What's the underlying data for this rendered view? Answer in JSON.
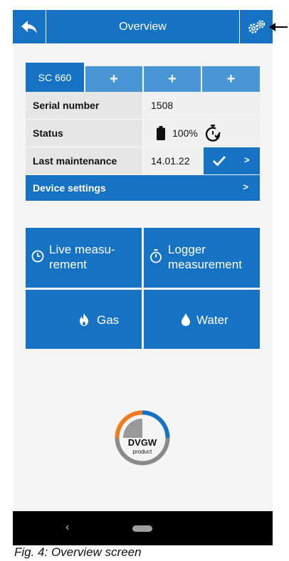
{
  "header": {
    "title": "Overview"
  },
  "tabs": {
    "active_label": "SC 660",
    "add_label": "+"
  },
  "info_rows": {
    "serial": {
      "label": "Serial number",
      "value": "1508"
    },
    "status": {
      "label": "Status",
      "battery_value": "100%"
    },
    "maintenance": {
      "label": "Last maintenance",
      "value": "14.01.22",
      "chevron": ">"
    }
  },
  "device_settings": {
    "label": "Device settings",
    "chevron": ">"
  },
  "tiles": {
    "live": {
      "line1": "Live measu-",
      "line2": "rement"
    },
    "logger": {
      "line1": "Logger",
      "line2": "measurement"
    },
    "gas": {
      "label": "Gas"
    },
    "water": {
      "label": "Water"
    }
  },
  "logo": {
    "text": "DVGW",
    "subtext": "product"
  },
  "navigation": {
    "back_glyph": "‹"
  },
  "caption": "Fig. 4: Overview screen",
  "colors": {
    "primary": "#1673c4",
    "tab_secondary": "#4896d6",
    "orange": "#f07b1d"
  }
}
